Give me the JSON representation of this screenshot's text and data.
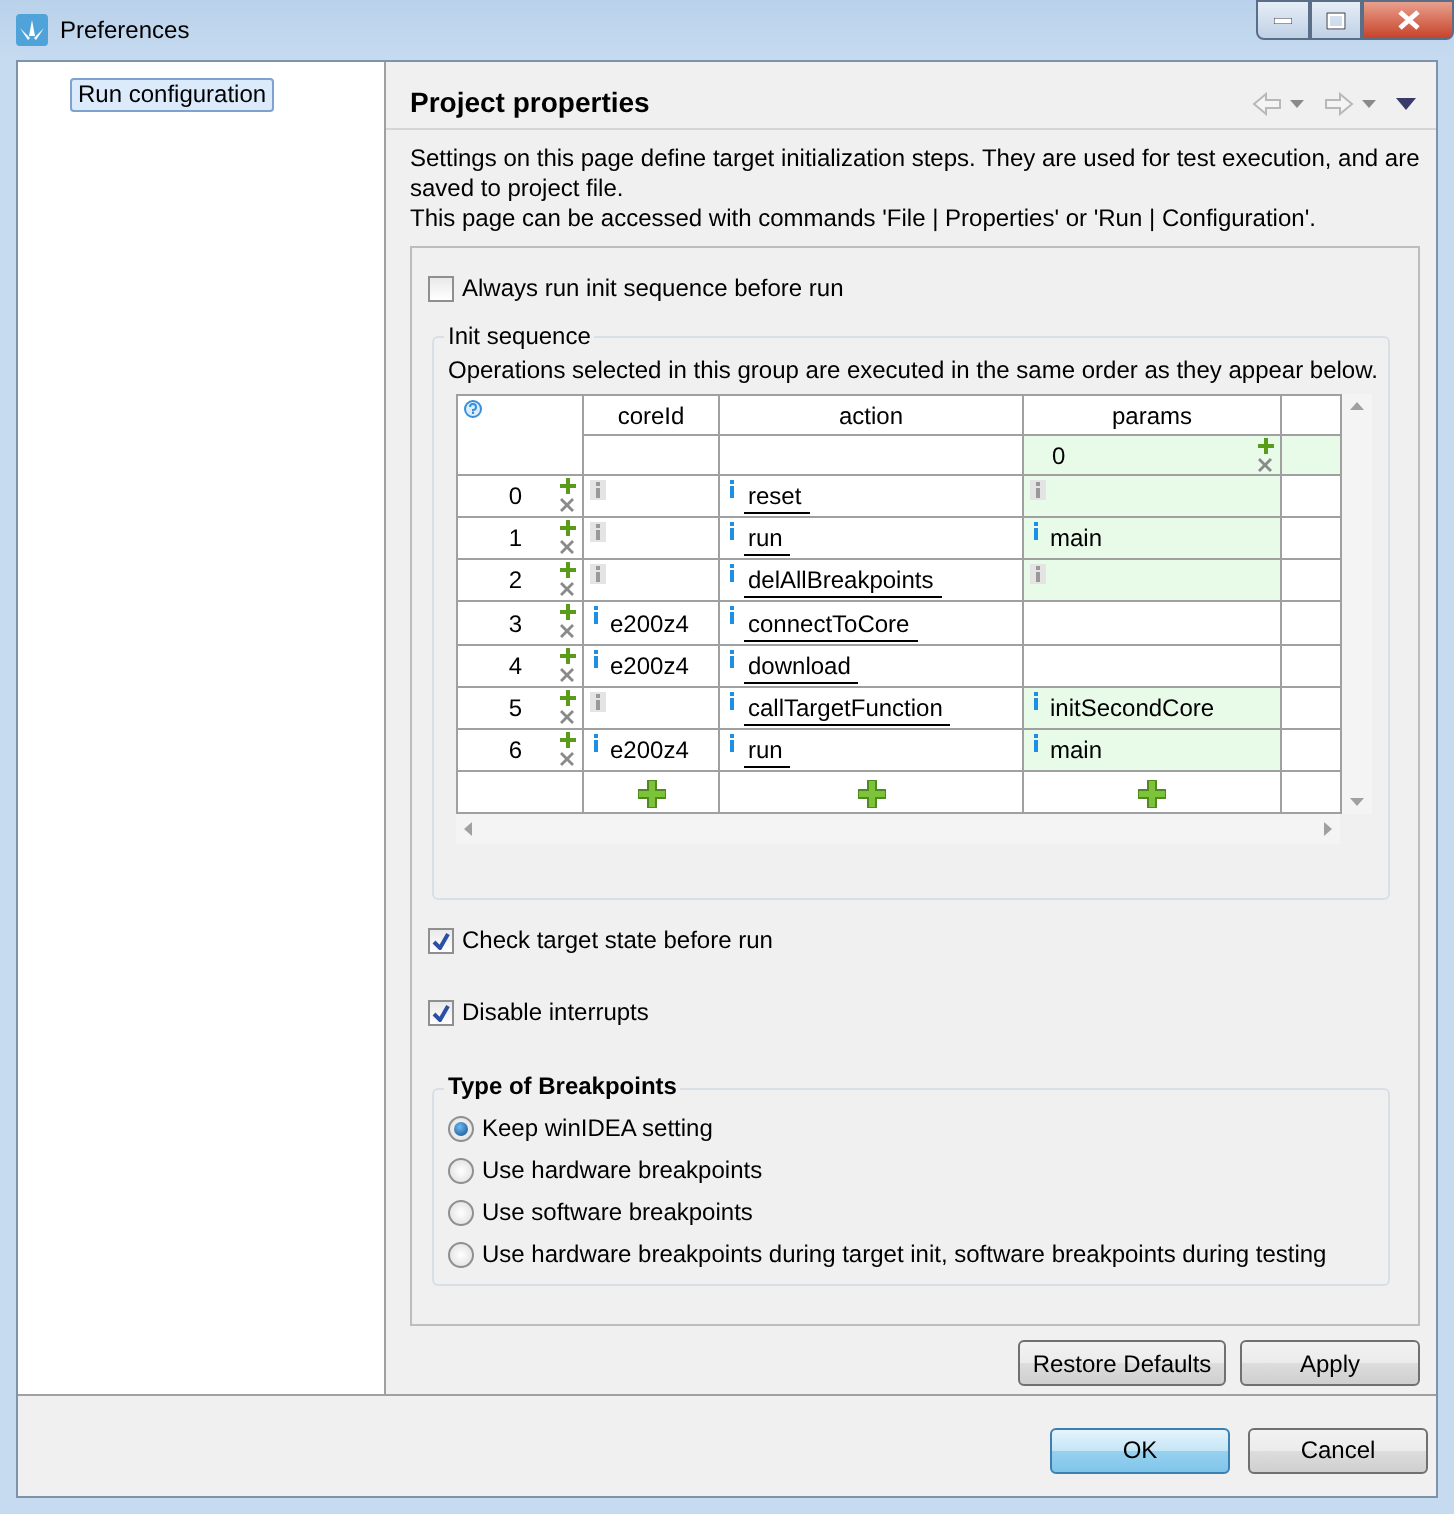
{
  "window": {
    "title": "Preferences"
  },
  "sidebar": {
    "items": [
      {
        "label": "Run configuration",
        "selected": true
      }
    ]
  },
  "page": {
    "title": "Project properties",
    "description": [
      "Settings on this page define target initialization steps. They are used for test execution, and are saved to project file.",
      "This page can be accessed with commands 'File | Properties' or 'Run | Configuration'."
    ]
  },
  "always_run": {
    "label": "Always run init sequence before run",
    "checked": false
  },
  "init_sequence": {
    "title": "Init sequence",
    "note": "Operations selected in this group are executed in the same order as they appear below.",
    "table": {
      "columns": [
        "coreId",
        "action",
        "params"
      ],
      "filter": [
        {
          "highlighted": false
        },
        {
          "highlighted": false
        },
        {
          "value": "0",
          "highlighted": true
        }
      ],
      "rows": [
        {
          "index": "0",
          "cells": [
            {
              "kind": "unset",
              "highlighted": false
            },
            {
              "value": "reset",
              "kind": "set",
              "highlighted": false
            },
            {
              "kind": "unset",
              "highlighted": true
            }
          ]
        },
        {
          "index": "1",
          "cells": [
            {
              "kind": "unset",
              "highlighted": false
            },
            {
              "value": "run",
              "kind": "set",
              "highlighted": false
            },
            {
              "value": "main",
              "kind": "set",
              "highlighted": true
            }
          ]
        },
        {
          "index": "2",
          "cells": [
            {
              "kind": "unset",
              "highlighted": false
            },
            {
              "value": "delAllBreakpoints",
              "kind": "set",
              "highlighted": false
            },
            {
              "kind": "unset",
              "highlighted": true
            }
          ]
        },
        {
          "index": "3",
          "cells": [
            {
              "value": "e200z4",
              "kind": "set",
              "highlighted": false
            },
            {
              "value": "connectToCore",
              "kind": "set",
              "highlighted": false
            },
            {
              "kind": "plain",
              "highlighted": false
            }
          ]
        },
        {
          "index": "4",
          "cells": [
            {
              "value": "e200z4",
              "kind": "set",
              "highlighted": false
            },
            {
              "value": "download",
              "kind": "set",
              "highlighted": false
            },
            {
              "kind": "plain",
              "highlighted": false
            }
          ]
        },
        {
          "index": "5",
          "cells": [
            {
              "kind": "unset",
              "highlighted": false
            },
            {
              "value": "callTargetFunction",
              "kind": "set",
              "highlighted": false
            },
            {
              "value": "initSecondCore",
              "kind": "set",
              "highlighted": true
            }
          ]
        },
        {
          "index": "6",
          "cells": [
            {
              "value": "e200z4",
              "kind": "set",
              "highlighted": false
            },
            {
              "value": "run",
              "kind": "set",
              "highlighted": false
            },
            {
              "value": "main",
              "kind": "set",
              "highlighted": true
            }
          ]
        }
      ]
    }
  },
  "options": [
    {
      "label": "Check target state before run",
      "checked": true
    },
    {
      "label": "Disable interrupts",
      "checked": true
    }
  ],
  "breakpoints": {
    "title": "Type of Breakpoints",
    "options": [
      {
        "label": "Keep winIDEA setting",
        "selected": true
      },
      {
        "label": "Use hardware breakpoints",
        "selected": false
      },
      {
        "label": "Use software breakpoints",
        "selected": false
      },
      {
        "label": "Use hardware breakpoints during target init, software breakpoints during testing",
        "selected": false
      }
    ]
  },
  "page_buttons": [
    {
      "label": "Restore Defaults"
    },
    {
      "label": "Apply"
    }
  ],
  "dialog_buttons": [
    {
      "label": "OK",
      "default": true
    },
    {
      "label": "Cancel",
      "default": false
    }
  ]
}
